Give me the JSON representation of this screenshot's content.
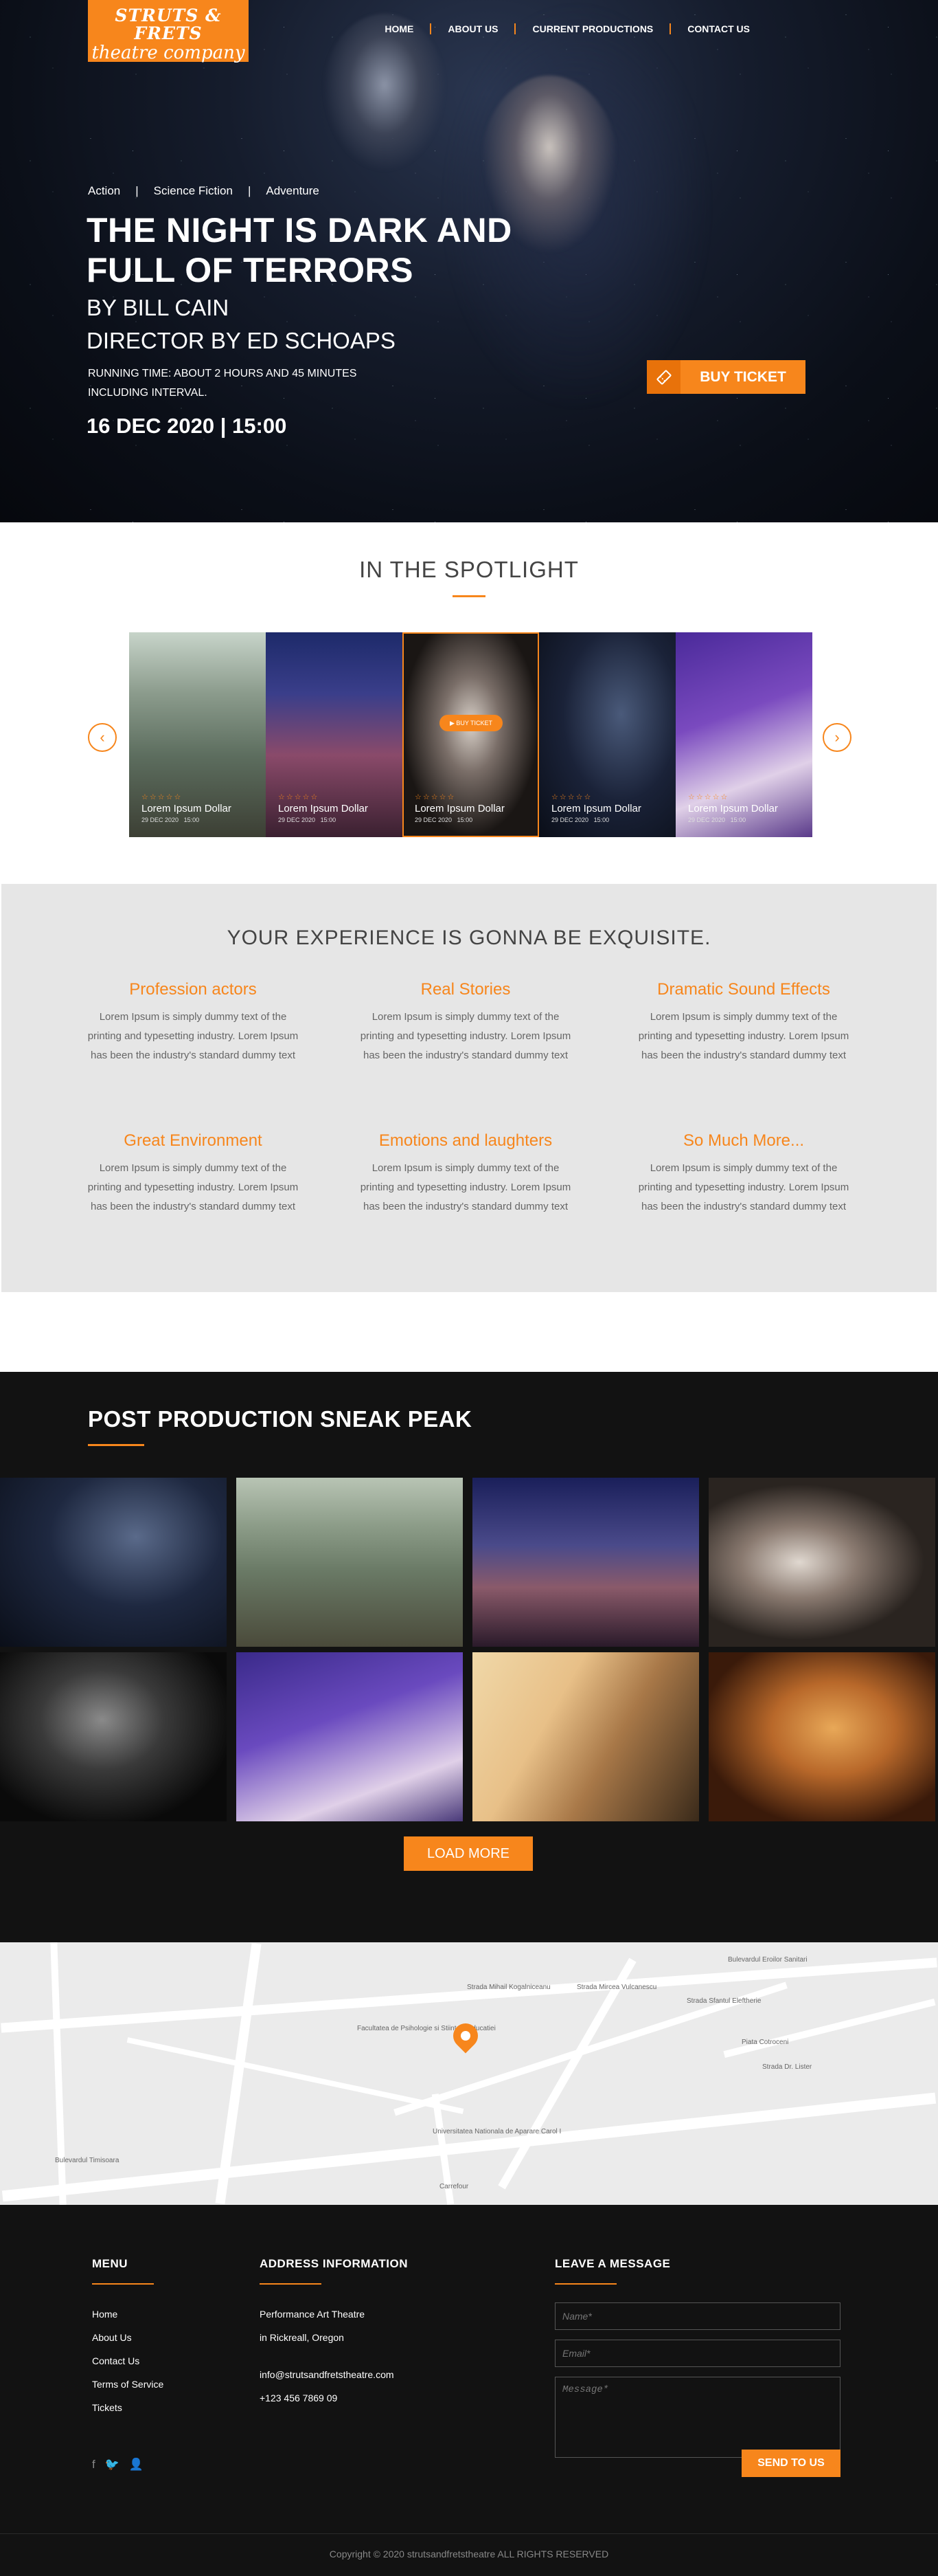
{
  "brand": {
    "line1": "STRUTS & FRETS",
    "line2": "theatre company"
  },
  "nav": {
    "items": [
      "HOME",
      "ABOUT US",
      "CURRENT PRODUCTIONS",
      "CONTACT US"
    ]
  },
  "hero": {
    "genres": [
      "Action",
      "Science Fiction",
      "Adventure"
    ],
    "genre_sep": "|",
    "title": "THE NIGHT IS DARK AND FULL OF TERRORS",
    "author": "BY BILL CAIN",
    "director": "DIRECTOR BY ED SCHOAPS",
    "running": "RUNNING TIME: ABOUT 2 HOURS AND 45 MINUTES INCLUDING INTERVAL.",
    "date": "16 DEC 2020 | 15:00",
    "buy_label": "BUY TICKET",
    "buy_icon": "ticket-icon"
  },
  "spotlight": {
    "title": "IN THE SPOTLIGHT",
    "prev_icon": "chevron-left-icon",
    "next_icon": "chevron-right-icon",
    "slides": [
      {
        "title": "Lorem Ipsum Dollar",
        "date": "29 DEC 2020",
        "time": "15:00",
        "rating": "☆☆☆☆☆"
      },
      {
        "title": "Lorem Ipsum Dollar",
        "date": "29 DEC 2020",
        "time": "15:00",
        "rating": "☆☆☆☆☆"
      },
      {
        "title": "Lorem Ipsum Dollar",
        "date": "29 DEC 2020",
        "time": "15:00",
        "rating": "☆☆☆☆☆",
        "button": "BUY TICKET"
      },
      {
        "title": "Lorem Ipsum Dollar",
        "date": "29 DEC 2020",
        "time": "15:00",
        "rating": "☆☆☆☆☆"
      },
      {
        "title": "Lorem Ipsum Dollar",
        "date": "29 DEC 2020",
        "time": "15:00",
        "rating": "☆☆☆☆☆"
      }
    ]
  },
  "experience": {
    "title": "YOUR EXPERIENCE IS GONNA BE EXQUISITE.",
    "features": [
      {
        "title": "Profession actors",
        "text": "Lorem Ipsum is simply dummy text of the printing and typesetting industry. Lorem Ipsum has been the industry's standard dummy text"
      },
      {
        "title": "Real Stories",
        "text": "Lorem Ipsum is simply dummy text of the printing and typesetting industry. Lorem Ipsum has been the industry's standard dummy text"
      },
      {
        "title": "Dramatic Sound Effects",
        "text": "Lorem Ipsum is simply dummy text of the printing and typesetting industry. Lorem Ipsum has been the industry's standard dummy text"
      },
      {
        "title": "Great Environment",
        "text": "Lorem Ipsum is simply dummy text of the printing and typesetting industry. Lorem Ipsum has been the industry's standard dummy text"
      },
      {
        "title": "Emotions and laughters",
        "text": "Lorem Ipsum is simply dummy text of the printing and typesetting industry. Lorem Ipsum has been the industry's standard dummy text"
      },
      {
        "title": "So Much More...",
        "text": "Lorem Ipsum is simply dummy text of the printing and typesetting industry. Lorem Ipsum has been the industry's standard dummy text"
      }
    ]
  },
  "sneak": {
    "title": "POST PRODUCTION SNEAK PEAK",
    "load_more": "LOAD MORE"
  },
  "map": {
    "labels": [
      "Strada Mihail Kogalniceanu",
      "Facultatea de Psihologie si Stiintele Educatiei",
      "Universitatea Nationala de Aparare Carol I",
      "Strada Sfantul Eleftherie",
      "Bulevardul Eroilor Sanitari",
      "Strada Mircea Vulcanescu",
      "Bulevardul Timisoara",
      "Carrefour",
      "Piata Cotroceni",
      "Strada Dr. Lister"
    ],
    "pin_icon": "map-pin-icon"
  },
  "footer": {
    "menu_title": "MENU",
    "menu": [
      "Home",
      "About Us",
      "Contact Us",
      "Terms of Service",
      "Tickets"
    ],
    "address_title": "ADDRESS INFORMATION",
    "address": [
      "Performance Art Theatre",
      "in Rickreall, Oregon"
    ],
    "email": "info@strutsandfretstheatre.com",
    "phone": "+123 456 7869 09",
    "message_title": "LEAVE A MESSAGE",
    "name_placeholder": "Name*",
    "email_placeholder": "Email*",
    "message_placeholder": "Message*",
    "send_label": "SEND TO US",
    "social": [
      "facebook-icon",
      "twitter-icon",
      "user-icon"
    ],
    "copyright": "Copyright © 2020 strutsandfretstheatre ALL RIGHTS RESERVED"
  },
  "colors": {
    "accent": "#f7861c",
    "dark": "#121212",
    "light_panel": "#e6e6e6"
  }
}
